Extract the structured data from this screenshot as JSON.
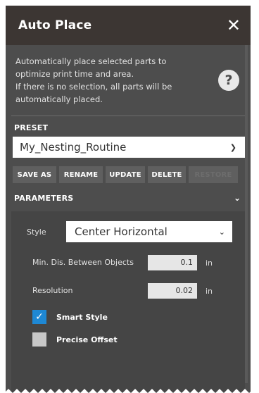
{
  "window": {
    "title": "Auto Place",
    "close_icon": "close-icon"
  },
  "description": {
    "lines": [
      "Automatically place selected parts to",
      "optimize print time and area.",
      "If there is no selection, all parts will be",
      "automatically placed."
    ],
    "help_label": "?"
  },
  "preset": {
    "label": "PRESET",
    "selected": "My_Nesting_Routine",
    "buttons": [
      "SAVE AS",
      "RENAME",
      "UPDATE",
      "DELETE",
      "RESTORE"
    ]
  },
  "parameters": {
    "label": "PARAMETERS",
    "style_label": "Style",
    "style_value": "Center Horizontal",
    "min_dist_label": "Min. Dis. Between Objects",
    "min_dist_value": "0.1",
    "min_dist_unit": "in",
    "resolution_label": "Resolution",
    "resolution_value": "0.02",
    "resolution_unit": "in",
    "smart_style_label": "Smart Style",
    "smart_style_checked": true,
    "precise_offset_label": "Precise Offset",
    "precise_offset_checked": false
  },
  "colors": {
    "panel_bg": "#4d4d4d",
    "titlebar_bg": "#3c3633",
    "checkbox_accent": "#1e88d4"
  }
}
